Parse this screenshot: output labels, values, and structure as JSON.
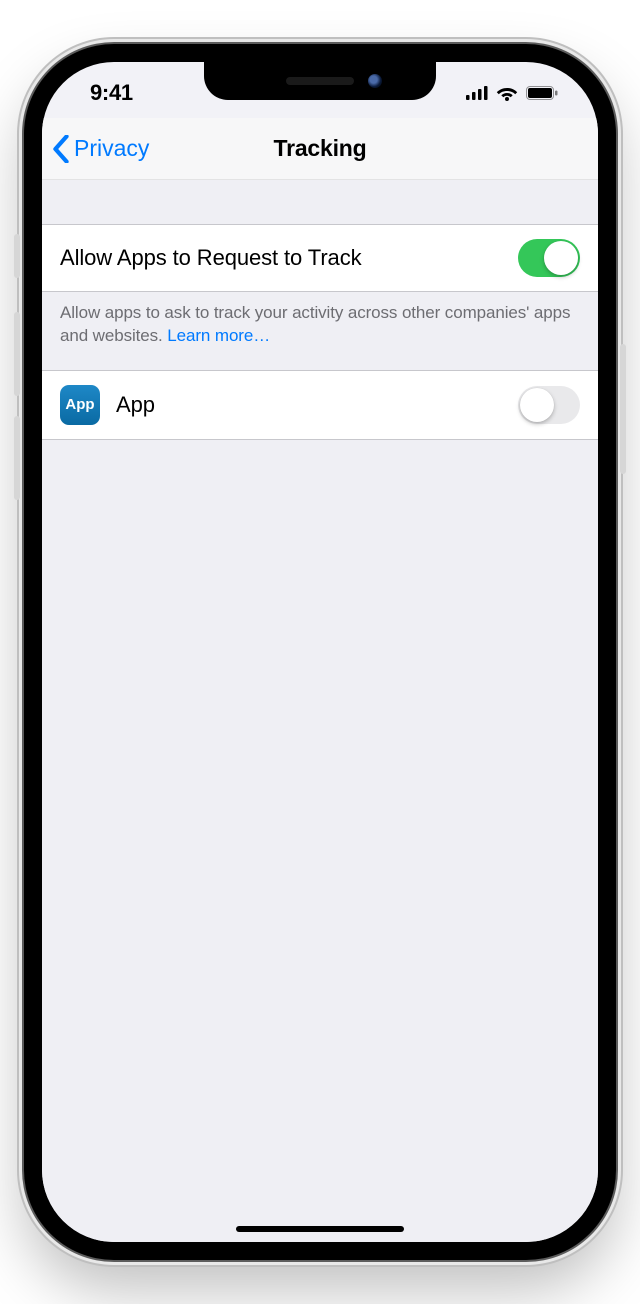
{
  "statusbar": {
    "time": "9:41"
  },
  "nav": {
    "back_label": "Privacy",
    "title": "Tracking"
  },
  "settings": {
    "allow_tracking": {
      "label": "Allow Apps to Request to Track",
      "value": true,
      "footer": "Allow apps to ask to track your activity across other companies' apps and websites. ",
      "learn_more": "Learn more…"
    },
    "apps": [
      {
        "name": "App",
        "icon_label": "App",
        "tracking_allowed": false
      }
    ]
  }
}
